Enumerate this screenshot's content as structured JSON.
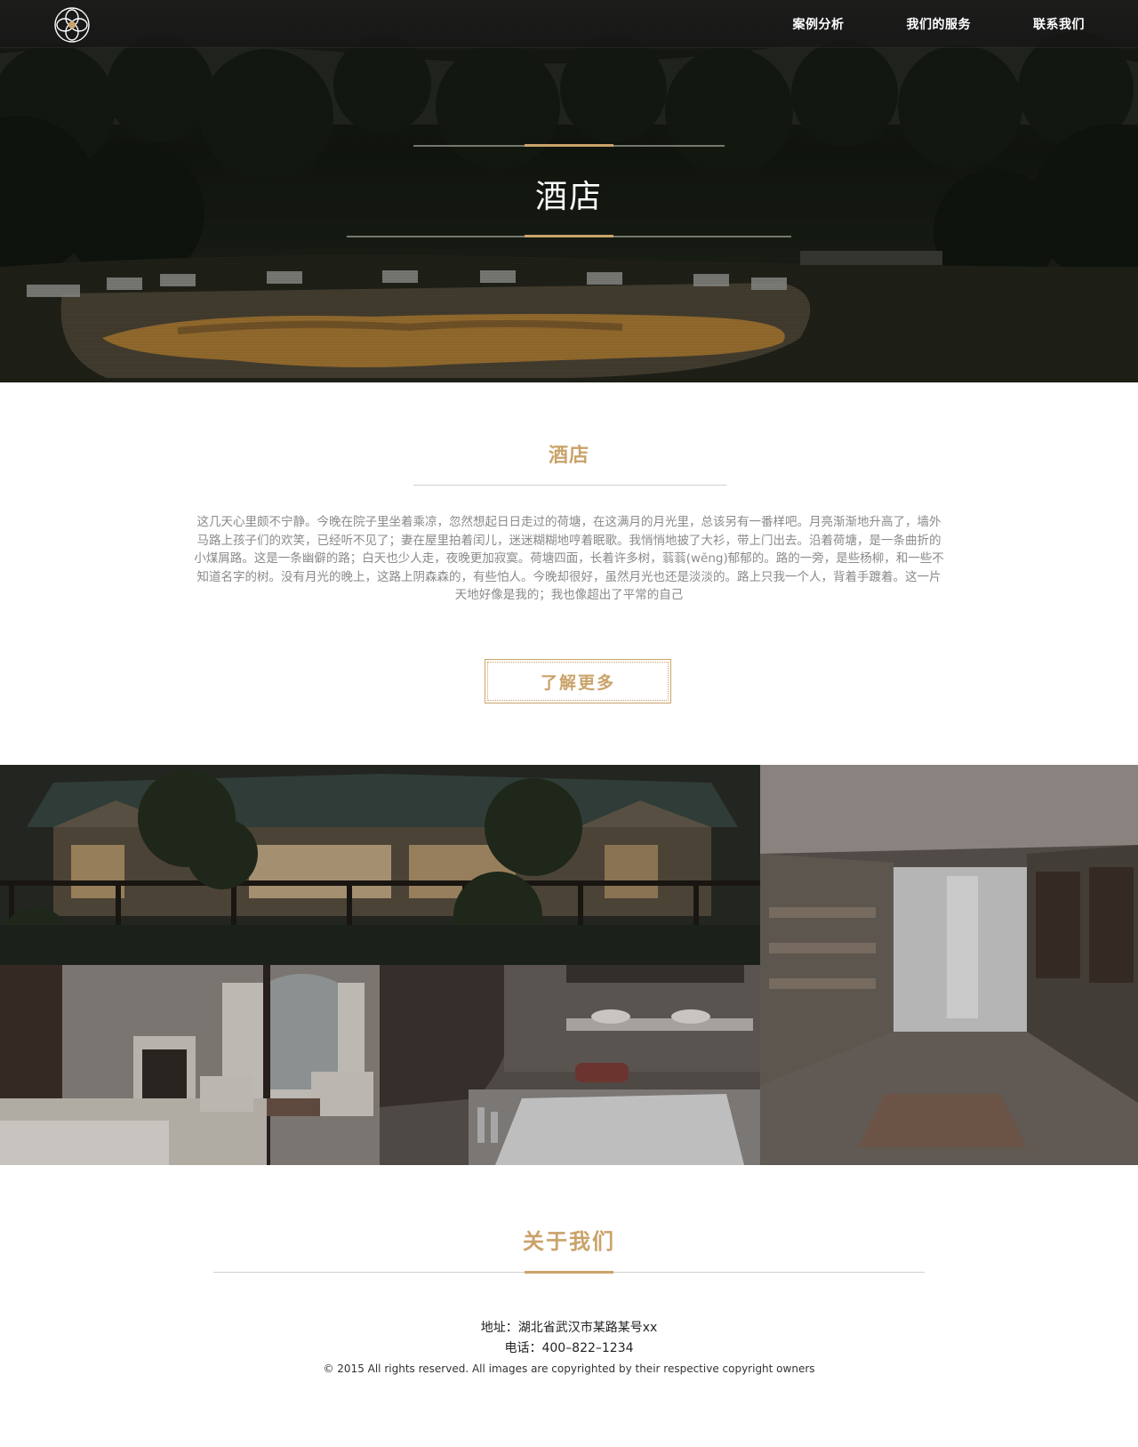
{
  "nav": {
    "items": [
      {
        "label": "案例分析"
      },
      {
        "label": "我们的服务"
      },
      {
        "label": "联系我们"
      }
    ],
    "logo_icon": "lotus-logo-icon"
  },
  "hero": {
    "title": "酒店"
  },
  "intro": {
    "title": "酒店",
    "text": "这几天心里颇不宁静。今晚在院子里坐着乘凉，忽然想起日日走过的荷塘，在这满月的月光里，总该另有一番样吧。月亮渐渐地升高了，墙外马路上孩子们的欢笑，已经听不见了；妻在屋里拍着闰儿，迷迷糊糊地哼着眠歌。我悄悄地披了大衫，带上门出去。沿着荷塘，是一条曲折的小煤屑路。这是一条幽僻的路；白天也少人走，夜晚更加寂寞。荷塘四面，长着许多树，蓊蓊(wěng)郁郁的。路的一旁，是些杨柳，和一些不知道名字的树。没有月光的晚上，这路上阴森森的，有些怕人。今晚却很好，虽然月光也还是淡淡的。路上只我一个人，背着手踱着。这一片天地好像是我的；我也像超出了平常的自己",
    "button_label": "了解更多"
  },
  "gallery": {
    "images": [
      {
        "name": "safari-tent-lodge-image"
      },
      {
        "name": "stone-corridor-shop-image"
      },
      {
        "name": "four-poster-bedroom-image"
      },
      {
        "name": "stone-bathroom-image"
      }
    ]
  },
  "about": {
    "title": "关于我们",
    "address": "地址：湖北省武汉市某路某号xx",
    "phone": "电话：400–822–1234",
    "copyright": "© 2015 All rights reserved. All images are copyrighted by their respective copyright owners"
  },
  "colors": {
    "accent": "#caa36a",
    "nav_bg": "#181818",
    "body_text": "#8a8a8a"
  }
}
